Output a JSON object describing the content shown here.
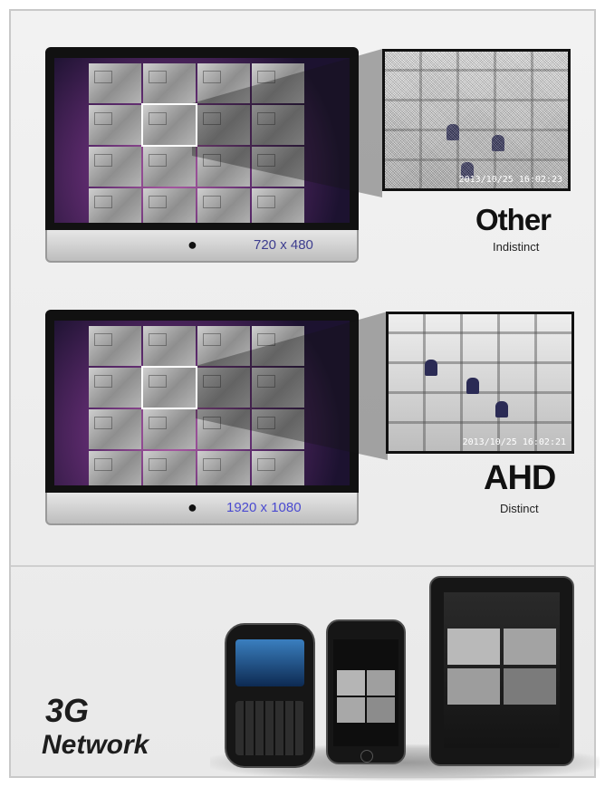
{
  "comparison": [
    {
      "monitor_resolution": "720 x 480",
      "label": "Other",
      "sublabel": "Indistinct",
      "resolution_color": "#3d3d8f",
      "zoom_timestamp": "2013/10/25 16:02:23"
    },
    {
      "monitor_resolution": "1920 x 1080",
      "label": "AHD",
      "sublabel": "Distinct",
      "resolution_color": "#4a4ad0",
      "zoom_timestamp": "2013/10/25 16:02:21"
    }
  ],
  "network": {
    "line1": "3G",
    "line2": "Network"
  },
  "devices": [
    "blackberry-phone",
    "iphone",
    "ipad"
  ]
}
